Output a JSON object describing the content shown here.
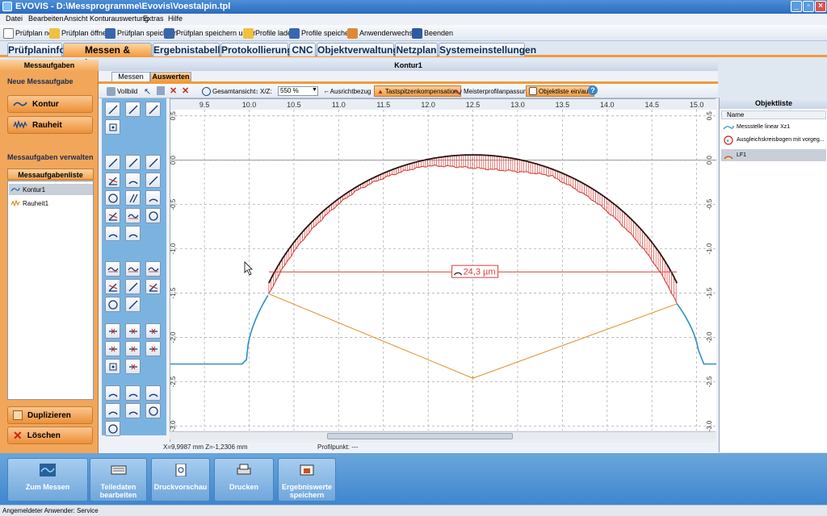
{
  "window": {
    "title": "EVOVIS - D:\\Messprogramme\\Evovis\\Voestalpin.tpl"
  },
  "menu": [
    "Datei",
    "Bearbeiten",
    "Ansicht",
    "Konturauswertung",
    "Extras",
    "Hilfe"
  ],
  "toolbar": [
    "Prüfplan neu",
    "Prüfplan öffnen",
    "Prüfplan speichern",
    "Prüfplan speichern unter",
    "Profile laden",
    "Profile speichern",
    "Anwenderwechsel",
    "Beenden"
  ],
  "main_tabs": [
    "Prüfplaninfo",
    "Messen & Auswerten",
    "Ergebnistabelle",
    "Protokollierung",
    "CNC",
    "Objektverwaltung",
    "Netzplan",
    "Systemeinstellungen"
  ],
  "main_tabs_active": 1,
  "left_panel": {
    "header": "Messaufgaben",
    "new_section": "Neue Messaufgabe",
    "btn_kontur": "Kontur",
    "btn_rauheit": "Rauheit",
    "manage_section": "Messaufgaben verwalten",
    "list_header": "Messaufgabenliste",
    "tasks": [
      "Kontur1",
      "Rauheit1"
    ],
    "btn_duplicate": "Duplizieren",
    "btn_delete": "Löschen"
  },
  "center": {
    "header": "Kontur1",
    "subtab_messen": "Messen",
    "subtab_auswerten": "Auswerten",
    "tb_vollbild": "Vollbild",
    "tb_gesamtansicht": "Gesamtansicht",
    "tb_xz": "X/Z:",
    "tb_zoom": "550 %",
    "tb_ausrichtbezug": "Ausrichtbezug",
    "tb_tastspitzen": "Tastspitzenkompensation",
    "tb_meisterprofil": "Meisterprofilanpassung",
    "tb_objektliste": "Objektliste ein/aus",
    "status_coords": "X=9,9987 mm Z=-1,2306 mm",
    "status_profilpunkt": "Profilpunkt: ---"
  },
  "chart_data": {
    "type": "line",
    "xlim": [
      9.12,
      15.22
    ],
    "ylim": [
      -3.05,
      0.57
    ],
    "x_ticks": [
      "9.5",
      "10.0",
      "10.5",
      "11.0",
      "11.5",
      "12.0",
      "12.5",
      "13.0",
      "13.5",
      "14.0",
      "14.5",
      "15.0"
    ],
    "y_ticks": [
      "0.5",
      "0.0",
      "-0.5",
      "-1.0",
      "-1.5",
      "-2.0",
      "-2.5",
      "-3.0"
    ],
    "grid": true,
    "circle_fit": {
      "cx": 12.5,
      "cz": -2.46,
      "r": 2.52
    },
    "reference_line": {
      "x1": 10.22,
      "x2": 14.78,
      "z": -1.26
    },
    "center_point": {
      "x": 12.5,
      "z": -2.46
    },
    "annotation": "24,3 µm",
    "colors": {
      "profile": "#2b8fc5",
      "deviation": "#d9403a",
      "circle": "#2a1410",
      "construction": "#e0912f"
    }
  },
  "object_list": {
    "header": "Objektliste",
    "col_name": "Name",
    "items": [
      "Messstelle linear Xz1",
      "Ausgleichskreisbogen mit vorgeg...",
      "LF1"
    ]
  },
  "bottom_buttons": [
    "Zum Messen",
    "Teiledaten bearbeiten",
    "Druckvorschau",
    "Drucken",
    "Ergebniswerte speichern"
  ],
  "user_bar": "Angemeldeter Anwender:   Service"
}
